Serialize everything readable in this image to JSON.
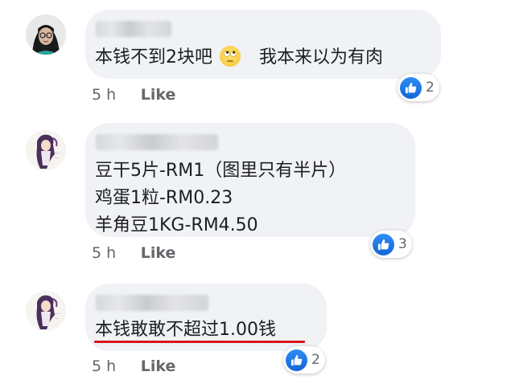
{
  "reaction_icon": "like-icon",
  "comments": [
    {
      "lines": [
        "本钱不到2块吧",
        "我本来以为有肉"
      ],
      "emoji": "rolling-eyes-emoji",
      "time": "5 h",
      "like_label": "Like",
      "reaction_count": "2"
    },
    {
      "lines": [
        "豆干5片-RM1（图里只有半片）",
        "鸡蛋1粒-RM0.23",
        "羊角豆1KG-RM4.50"
      ],
      "time": "5 h",
      "like_label": "Like",
      "reaction_count": "3"
    },
    {
      "lines": [
        "本钱敢敢不超过1.00钱"
      ],
      "time": "5 h",
      "like_label": "Like",
      "reaction_count": "2",
      "highlight_color": "#d9161e"
    }
  ]
}
